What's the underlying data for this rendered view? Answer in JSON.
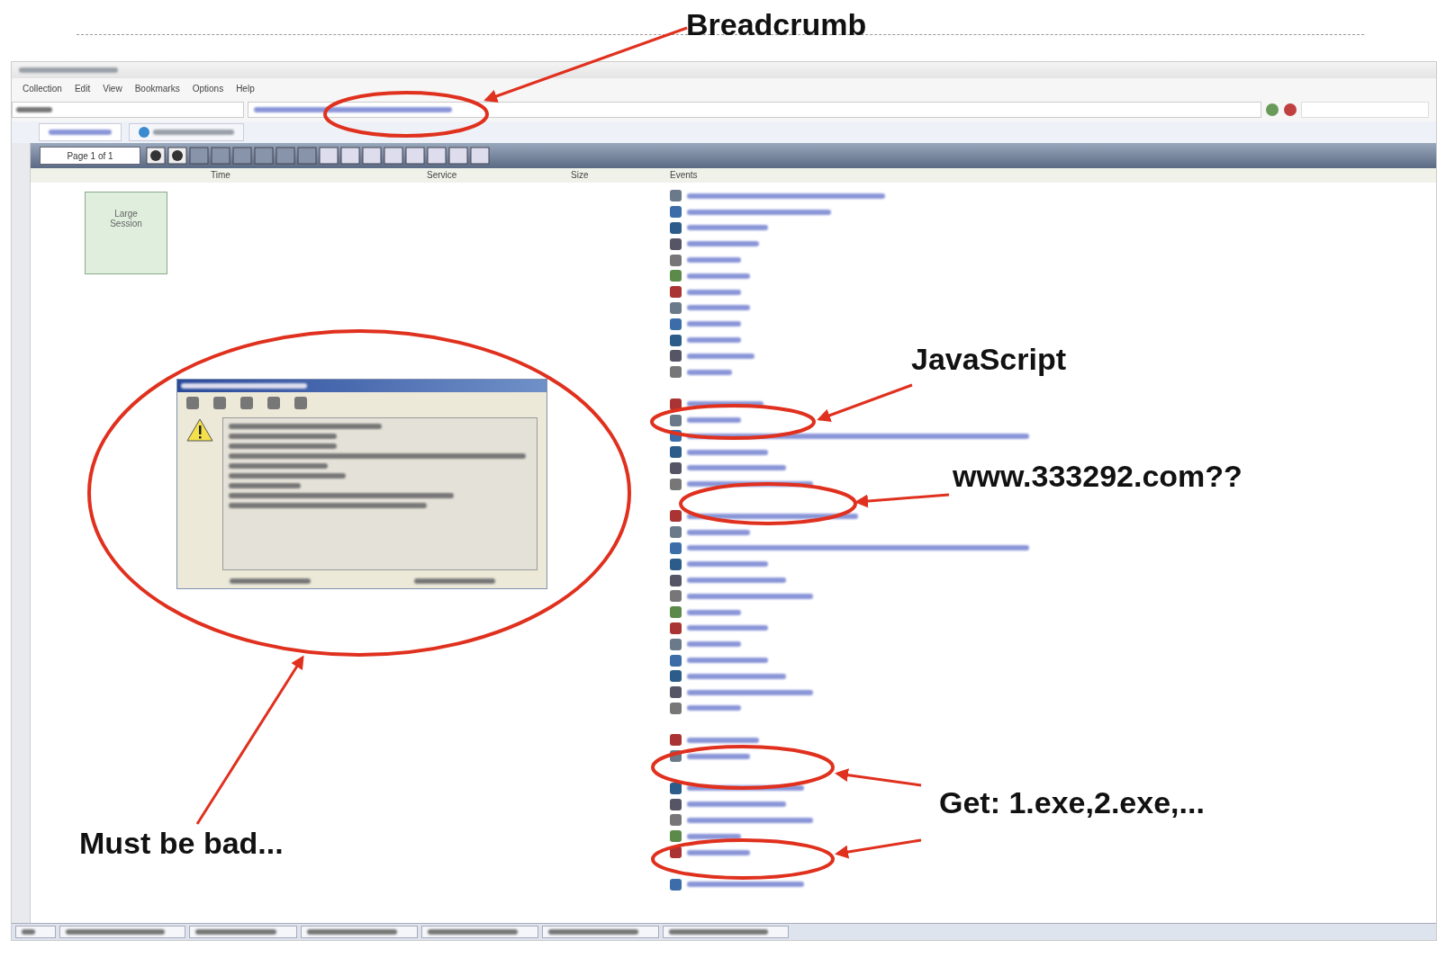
{
  "window": {
    "menu": [
      "Collection",
      "Edit",
      "View",
      "Bookmarks",
      "Options",
      "Help"
    ],
    "toolbar": {
      "page_field": "Page 1 of 1"
    },
    "table": {
      "columns": [
        "Time",
        "Service",
        "Size",
        "Events"
      ]
    },
    "session_thumbnail": {
      "label": "Large Session"
    }
  },
  "annotations": [
    {
      "text": "Breadcrumb"
    },
    {
      "text": "JavaScript"
    },
    {
      "text": "www.333292.com??"
    },
    {
      "text": "Get: 1.exe,2.exe,..."
    },
    {
      "text": "Must be bad..."
    }
  ]
}
